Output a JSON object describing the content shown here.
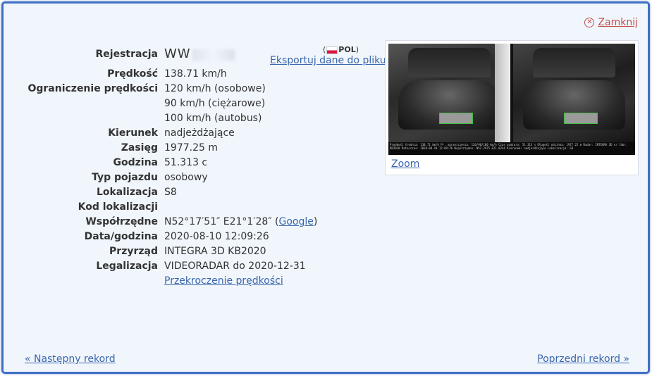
{
  "close": {
    "label": "Zamknij",
    "icon": "close-circle-icon",
    "color": "#c0504d"
  },
  "vehicle": {
    "registration_label": "Rejestracja",
    "registration_value": "WW",
    "country_code": "POL",
    "export_label": "Eksportuj dane do pliku"
  },
  "fields": [
    {
      "label": "Prędkość",
      "value": "138.71 km/h"
    },
    {
      "label": "Ograniczenie prędkości",
      "value": "120 km/h (osobowe)\n90 km/h (ciężarowe)\n100 km/h (autobus)"
    },
    {
      "label": "Kierunek",
      "value": "nadjeżdżające"
    },
    {
      "label": "Zasięg",
      "value": "1977.25 m"
    },
    {
      "label": "Godzina",
      "value": "51.313 c"
    },
    {
      "label": "Typ pojazdu",
      "value": "osobowy"
    },
    {
      "label": "Lokalizacja",
      "value": "S8"
    },
    {
      "label": "Kod lokalizacji",
      "value": ""
    },
    {
      "label": "Współrzędne",
      "value": "N52°17′51″ E21°1′28″ (",
      "link": "Google",
      "suffix": ")"
    },
    {
      "label": "Data/godzina",
      "value": "2020-08-10 12:09:26"
    },
    {
      "label": "Przyrząd",
      "value": "INTEGRA 3D KB2020"
    },
    {
      "label": "Legalizacja",
      "value": "VIDEORADAR do 2020-12-31"
    }
  ],
  "violation_link": "Przekroczenie prędkości",
  "photo": {
    "zoom_label": "Zoom",
    "caption": "Prędkość średnia: 138.71 km/h  Pr. ograniczenia: 120/90/100 km/h  Czas pomiaru: 51.313 s  Długość odcinka: 1977.25 m  Radar: INTEGRA 3D nr fabr. KB2020  Data/czas: 2020-08-10 12:09:26  Współrzędne: N52.2975 E21.0244  Kierunek: nadjeżdżające  Lokalizacja: S8"
  },
  "nav": {
    "next_record": "« Następny rekord",
    "prev_record": "Poprzedni rekord »"
  },
  "colors": {
    "accent": "#3f6fc6",
    "link": "#3a66ae",
    "panel_bg": "#f1f6fc"
  }
}
